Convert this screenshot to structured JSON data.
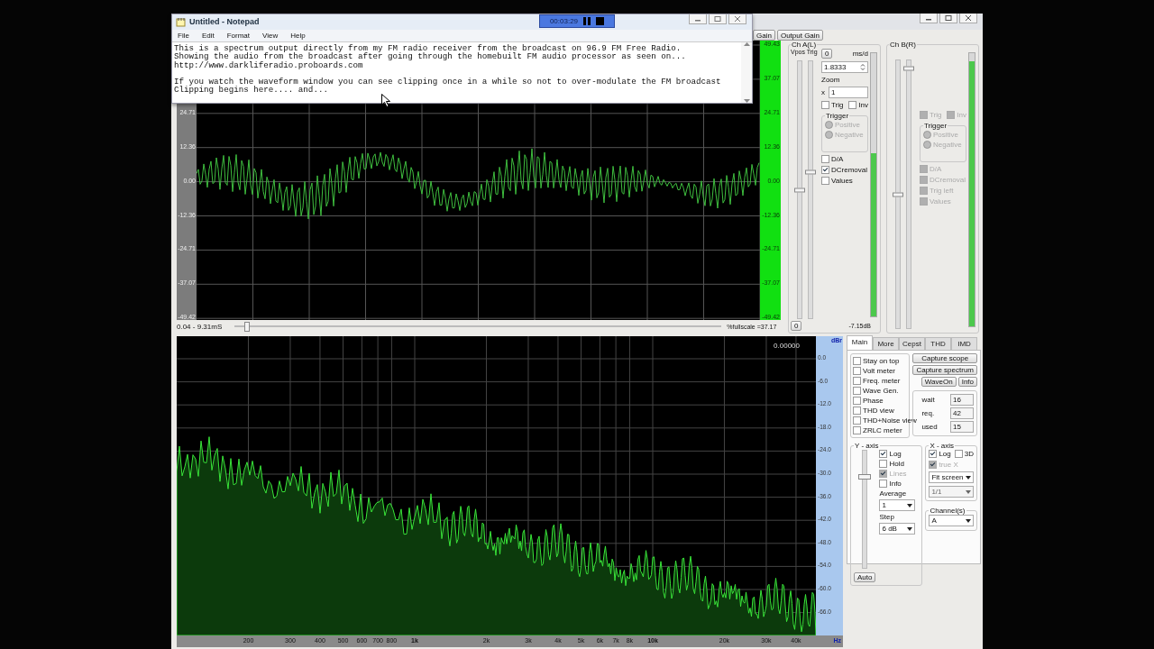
{
  "notepad": {
    "title": "Untitled - Notepad",
    "menu": [
      "File",
      "Edit",
      "Format",
      "View",
      "Help"
    ],
    "paragraphs": [
      [
        "This is a spectrum output directly from my FM radio receiver from the broadcast on 96.9 FM Free Radio.",
        "Showing the audio from the broadcast after going through the homebuilt FM audio processor as seen on...",
        "http://www.darkliferadio.proboards.com"
      ],
      [
        "If you watch the waveform window you can see clipping once in a while so not to over-modulate the FM broadcast",
        "Clipping begins here.... and..."
      ]
    ]
  },
  "recorder": {
    "time": "00:03:29"
  },
  "toolbar": [
    "Gain",
    "Output Gain"
  ],
  "scope": {
    "left_scale": [
      "24.71",
      "12.36",
      "0.00",
      "-12.36",
      "-24.71",
      "-37.07",
      "-49.42"
    ],
    "right_scale": [
      "49.43",
      "37.07",
      "24.71",
      "12.36",
      "0.00",
      "-12.36",
      "-24.71",
      "-37.07",
      "-49.42"
    ],
    "range": "0.04 - 9.31mS",
    "time_slider": {
      "level": 0.02
    },
    "fullscale": "%fullscale =37.17"
  },
  "channel_a": {
    "title": "Ch A(L)",
    "slider_labels": "Vpos Trig",
    "vpos": {
      "level": 0.5
    },
    "trig": {
      "level": 0.57
    },
    "meter": {
      "level": 0.62
    },
    "zero_button": "0",
    "unit": "ms/d",
    "timebase": "1.8333",
    "zoom_label": "Zoom",
    "zoom_prefix": "x",
    "zoom": "1",
    "toggles": [
      {
        "label": "Trig",
        "checked": false,
        "disabled": false
      },
      {
        "label": "Inv",
        "checked": false,
        "disabled": false
      }
    ],
    "trigger": {
      "title": "Trigger",
      "radios": [
        {
          "label": "Positive",
          "selected": false,
          "disabled": true
        },
        {
          "label": "Negative",
          "selected": false,
          "disabled": true
        }
      ]
    },
    "options": [
      {
        "label": "D/A",
        "checked": false,
        "disabled": false
      },
      {
        "label": "DCremoval",
        "checked": true,
        "disabled": false
      },
      {
        "label": "Values",
        "checked": false,
        "disabled": false
      }
    ],
    "bottom_button": "0",
    "reading": "-7.15dB"
  },
  "channel_b": {
    "title": "Ch B(R)",
    "vpos": {
      "level": 0.5
    },
    "trig": {
      "level": 0.97
    },
    "meter": {
      "level": 0.97
    },
    "toggles": [
      {
        "label": "Trig",
        "checked": false,
        "disabled": true
      },
      {
        "label": "Inv",
        "checked": false,
        "disabled": true
      }
    ],
    "trigger": {
      "title": "Trigger",
      "radios": [
        {
          "label": "Positive",
          "selected": false,
          "disabled": true
        },
        {
          "label": "Negative",
          "selected": false,
          "disabled": true
        }
      ]
    },
    "options": [
      {
        "label": "D/A",
        "checked": false,
        "disabled": true
      },
      {
        "label": "DCremoval",
        "checked": false,
        "disabled": true
      },
      {
        "label": "Trig left",
        "checked": false,
        "disabled": true
      },
      {
        "label": "Values",
        "checked": false,
        "disabled": true
      }
    ]
  },
  "spectrum": {
    "readout": "0.00000",
    "unit_y": "dBr",
    "db_scale": [
      "0.0",
      "-6.0",
      "-12.0",
      "-18.0",
      "-24.0",
      "-30.0",
      "-36.0",
      "-42.0",
      "-48.0",
      "-54.0",
      "-60.0",
      "-66.0"
    ],
    "freq_labels": [
      "200",
      "300",
      "400",
      "500",
      "600",
      "700",
      "800",
      "1k",
      "2k",
      "3k",
      "4k",
      "5k",
      "6k",
      "7k",
      "8k",
      "10k",
      "20k",
      "30k",
      "40k"
    ],
    "unit_x": "Hz"
  },
  "tabs": [
    {
      "label": "Main",
      "selected": true
    },
    {
      "label": "More",
      "selected": false
    },
    {
      "label": "Cepst",
      "selected": false
    },
    {
      "label": "THD",
      "selected": false
    },
    {
      "label": "IMD",
      "selected": false
    }
  ],
  "main_options": [
    {
      "label": "Stay on top",
      "checked": false
    },
    {
      "label": "Volt meter",
      "checked": false
    },
    {
      "label": "Freq. meter",
      "checked": false
    },
    {
      "label": "Wave Gen.",
      "checked": false
    },
    {
      "label": "Phase",
      "checked": false
    },
    {
      "label": "THD view",
      "checked": false
    },
    {
      "label": "THD+Noise view",
      "checked": false
    },
    {
      "label": "ZRLC meter",
      "checked": false
    }
  ],
  "capture_buttons": [
    "Capture scope",
    "Capture spectrum"
  ],
  "small_buttons": [
    "WaveOn",
    "Info"
  ],
  "stats": [
    {
      "label": "wait",
      "value": "16"
    },
    {
      "label": "req.",
      "value": "42"
    },
    {
      "label": "used",
      "value": "15"
    }
  ],
  "y_axis": {
    "title": "Y - axis",
    "slider": {
      "level": 0.78
    },
    "auto": "Auto",
    "options": [
      {
        "label": "Log",
        "checked": true,
        "disabled": false
      },
      {
        "label": "Hold",
        "checked": false,
        "disabled": false
      },
      {
        "label": "Lines",
        "checked": true,
        "disabled": true
      },
      {
        "label": "Info",
        "checked": false,
        "disabled": false
      }
    ],
    "average_label": "Average",
    "average": "1",
    "step_label": "Step",
    "step": "6 dB"
  },
  "x_axis": {
    "title": "X - axis",
    "options": [
      {
        "label": "Log",
        "checked": true,
        "disabled": false
      },
      {
        "label": "3D",
        "checked": false,
        "disabled": false
      }
    ],
    "true_x": {
      "label": "true X",
      "checked": true,
      "disabled": true
    },
    "fit": "Fit screen",
    "ratio": "1/1"
  },
  "channels": {
    "title": "Channel(s)",
    "value": "A"
  }
}
